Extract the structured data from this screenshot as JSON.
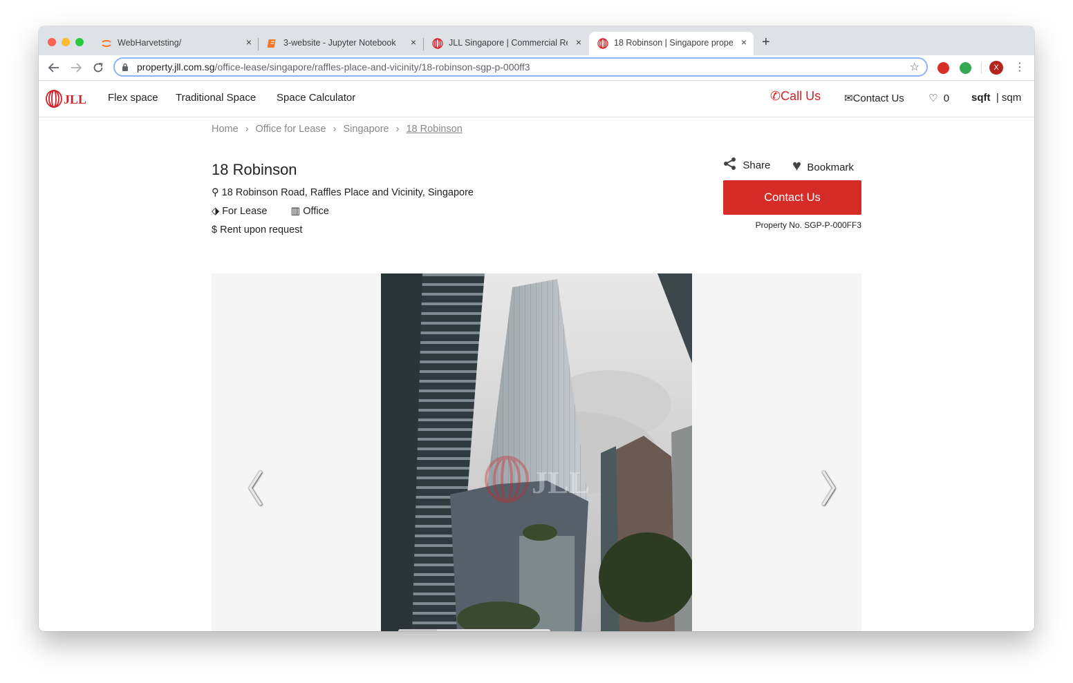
{
  "browser": {
    "tabs": [
      {
        "title": "WebHarvetsting/",
        "active": false
      },
      {
        "title": "3-website - Jupyter Notebook",
        "active": false
      },
      {
        "title": "JLL Singapore | Commercial Re",
        "active": false
      },
      {
        "title": "18 Robinson | Singapore prope",
        "active": true
      }
    ],
    "new_tab": "+",
    "close_glyph": "×",
    "url_host": "property.jll.com.sg",
    "url_path": "/office-lease/singapore/raffles-place-and-vicinity/18-robinson-sgp-p-000ff3",
    "profile_initial": "X"
  },
  "site": {
    "nav": [
      "Flex space",
      "Traditional Space",
      "Space Calculator"
    ],
    "call_us": "Call Us",
    "contact_us": "Contact Us",
    "favorites_count": "0",
    "unit_active": "sqft",
    "unit_other": "| sqm",
    "logo_text": "JLL"
  },
  "breadcrumb": [
    "Home",
    "Office for Lease",
    "Singapore",
    "18 Robinson"
  ],
  "property": {
    "title": "18 Robinson",
    "address": "18 Robinson Road, Raffles Place and Vicinity, Singapore",
    "lease_type": "For Lease",
    "property_type": "Office",
    "rent": "Rent upon request",
    "share_label": "Share",
    "bookmark_label": "Bookmark",
    "contact_button": "Contact Us",
    "property_no": "Property No. SGP-P-000FF3"
  },
  "gallery": {
    "prev_glyph": "〈",
    "next_glyph": "〉",
    "watermark": "JLL",
    "position_fraction": 0.25
  },
  "colors": {
    "brand_red": "#d41f26",
    "cta_red": "#d62b27",
    "focus_blue": "#8ab4f8"
  }
}
